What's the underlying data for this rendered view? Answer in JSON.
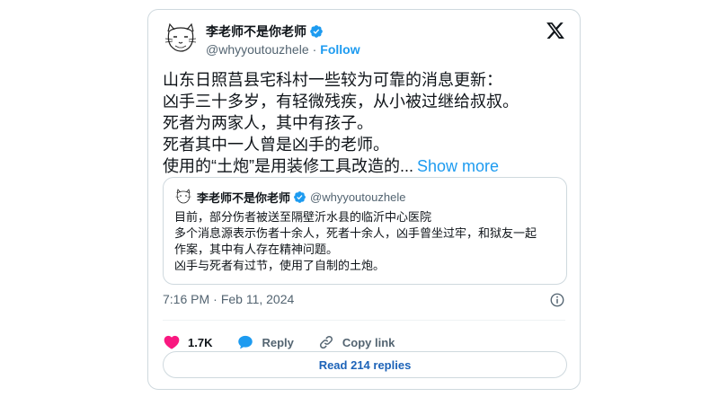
{
  "tweet": {
    "author": {
      "display_name": "李老师不是你老师",
      "handle": "@whyyoutouzhele",
      "verified": true,
      "avatar_icon": "cat-sketch-avatar"
    },
    "follow_label": "Follow",
    "separator": "·",
    "platform_icon": "x-logo-icon",
    "text_lines": [
      "山东日照莒县宅科村一些较为可靠的消息更新：",
      "凶手三十多岁，有轻微残疾，从小被过继给叔叔。",
      "死者为两家人，其中有孩子。",
      "死者其中一人曾是凶手的老师。",
      "使用的“土炮”是用装修工具改造的..."
    ],
    "show_more_label": "Show more",
    "quote": {
      "display_name": "李老师不是你老师",
      "handle": "@whyyoutouzhele",
      "lines": [
        "目前，部分伤者被送至隔壁沂水县的临沂中心医院",
        "多个消息源表示伤者十余人，死者十余人，凶手曾坐过牢，和狱友一起",
        "作案，其中有人存在精神问题。",
        "凶手与死者有过节，使用了自制的土炮。"
      ]
    },
    "time": "7:16 PM",
    "date_separator": "·",
    "date": "Feb 11, 2024",
    "likes": "1.7K",
    "reply_label": "Reply",
    "copy_link_label": "Copy link",
    "read_replies_label": "Read 214 replies",
    "colors": {
      "accent": "#1d9bf0",
      "like": "#f91880",
      "text": "#0f1419",
      "muted": "#536471",
      "border": "#cfd9de"
    }
  }
}
